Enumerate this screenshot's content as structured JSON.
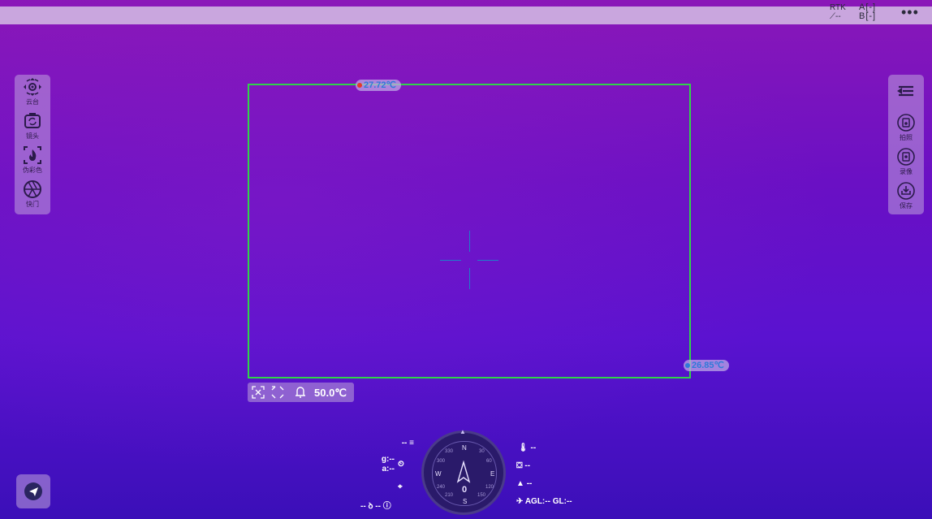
{
  "topbar": {
    "rtk_label": "RTK",
    "rtk_value": "--",
    "ab_label_a": "A[-]",
    "ab_label_b": "B[-]",
    "more": "•••"
  },
  "left_tools": [
    {
      "label": "云台",
      "icon": "gimbal-icon"
    },
    {
      "label": "镜头",
      "icon": "lens-switch-icon"
    },
    {
      "label": "伪彩色",
      "icon": "pseudo-color-icon"
    },
    {
      "label": "快门",
      "icon": "shutter-icon"
    }
  ],
  "right_tools": [
    {
      "label": "",
      "icon": "menu-list-icon"
    },
    {
      "label": "拍照",
      "icon": "photo-icon"
    },
    {
      "label": "录像",
      "icon": "record-icon"
    },
    {
      "label": "保存",
      "icon": "save-icon"
    }
  ],
  "thermal": {
    "max_temp": "27.72℃",
    "min_temp": "26.85℃",
    "alarm_temp": "50.0℃",
    "hot_color": "#e23b2b",
    "cold_color": "#2f7bd8",
    "frame_color": "#31d24a"
  },
  "telemetry": {
    "left_top": "--",
    "g": "g:--",
    "a": "a:--",
    "bottom_left_a": "--",
    "bottom_left_b": "--",
    "temp": "--",
    "height_a": "--",
    "height_b": "--",
    "agl": "AGL:--",
    "gl": "GL:--"
  },
  "compass": {
    "n": "N",
    "s": "S",
    "e": "E",
    "w": "W",
    "heading": "0",
    "t30": "30",
    "t60": "60",
    "t120": "120",
    "t150": "150",
    "t210": "210",
    "t240": "240",
    "t300": "300",
    "t330": "330"
  }
}
